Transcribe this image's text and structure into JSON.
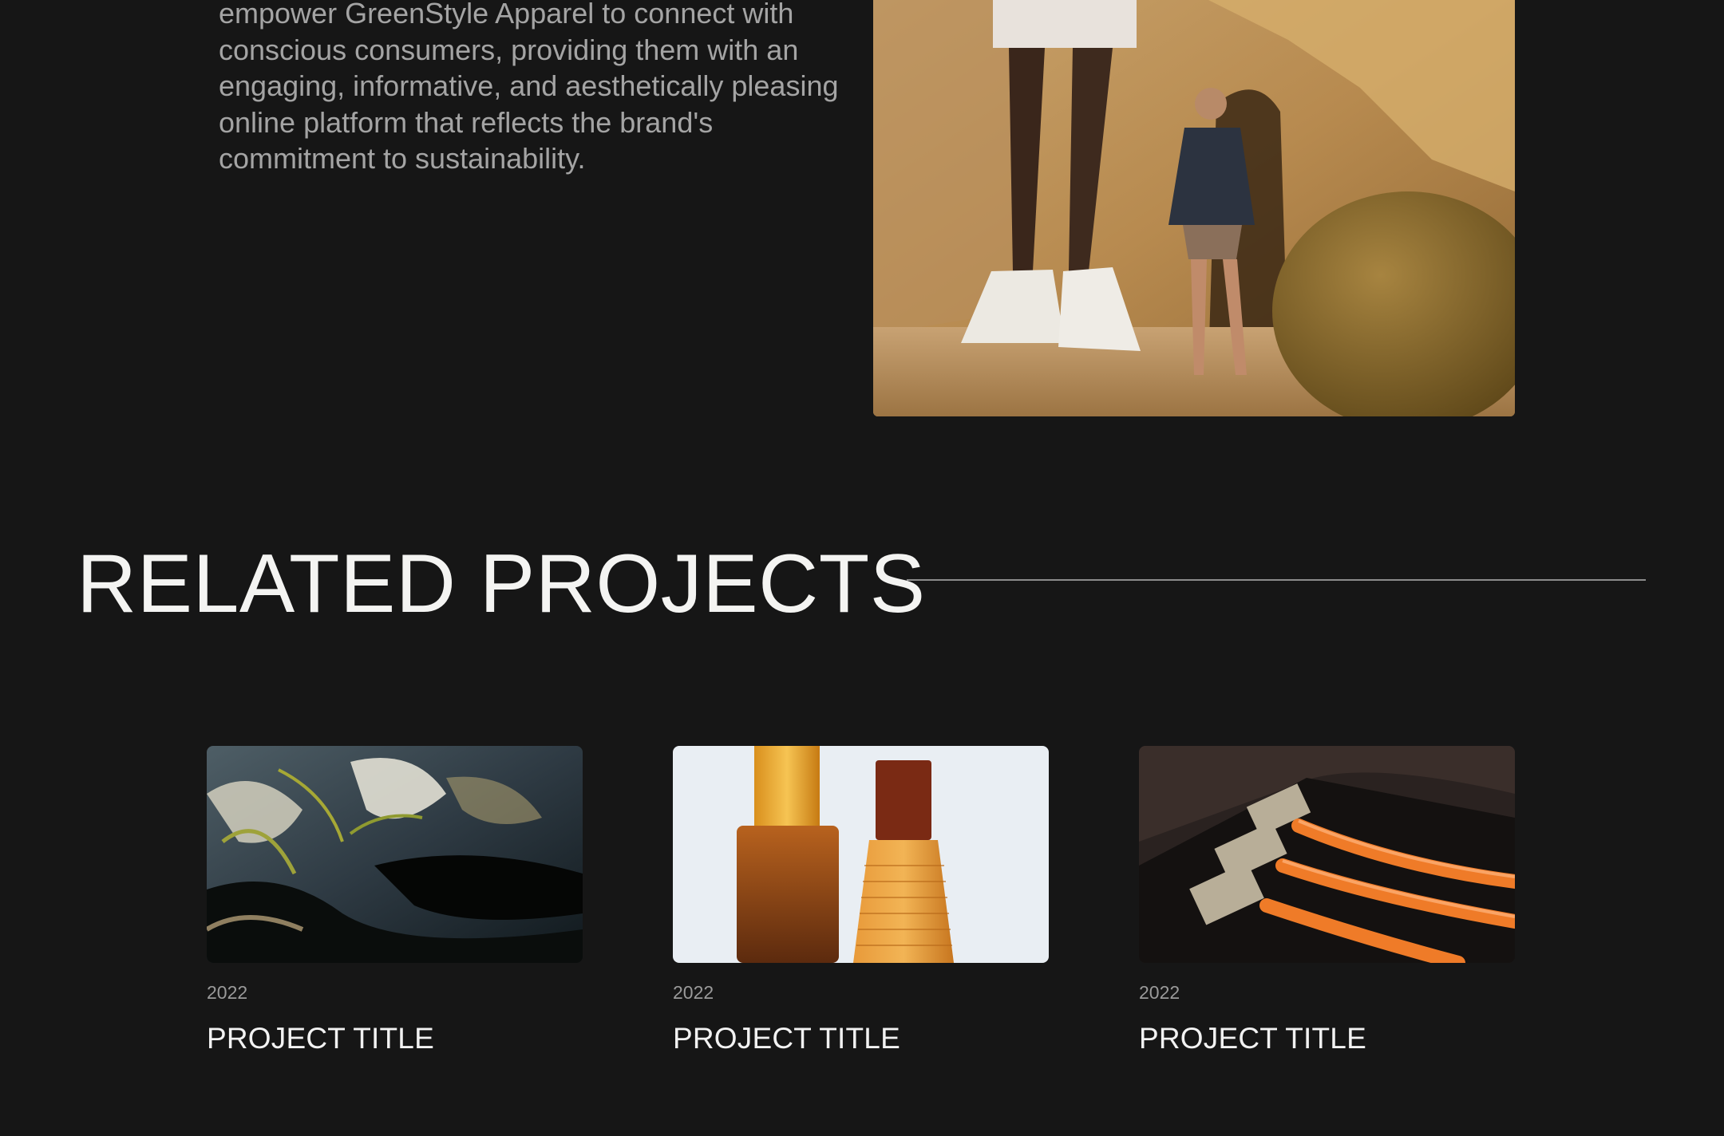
{
  "intro": {
    "paragraph": "empower GreenStyle Apparel to connect with conscious consumers, providing them with an engaging, informative, and aesthetically pleasing online platform that reflects the brand's commitment to sustainability."
  },
  "related": {
    "title": "RELATED PROJECTS",
    "projects": [
      {
        "year": "2022",
        "title": "PROJECT TITLE"
      },
      {
        "year": "2022",
        "title": "PROJECT TITLE"
      },
      {
        "year": "2022",
        "title": "PROJECT TITLE"
      }
    ]
  },
  "colors": {
    "background": "#161616",
    "heading": "#f4f4f2",
    "body_text": "#a4a4a4",
    "divider": "#8c8c8c"
  }
}
